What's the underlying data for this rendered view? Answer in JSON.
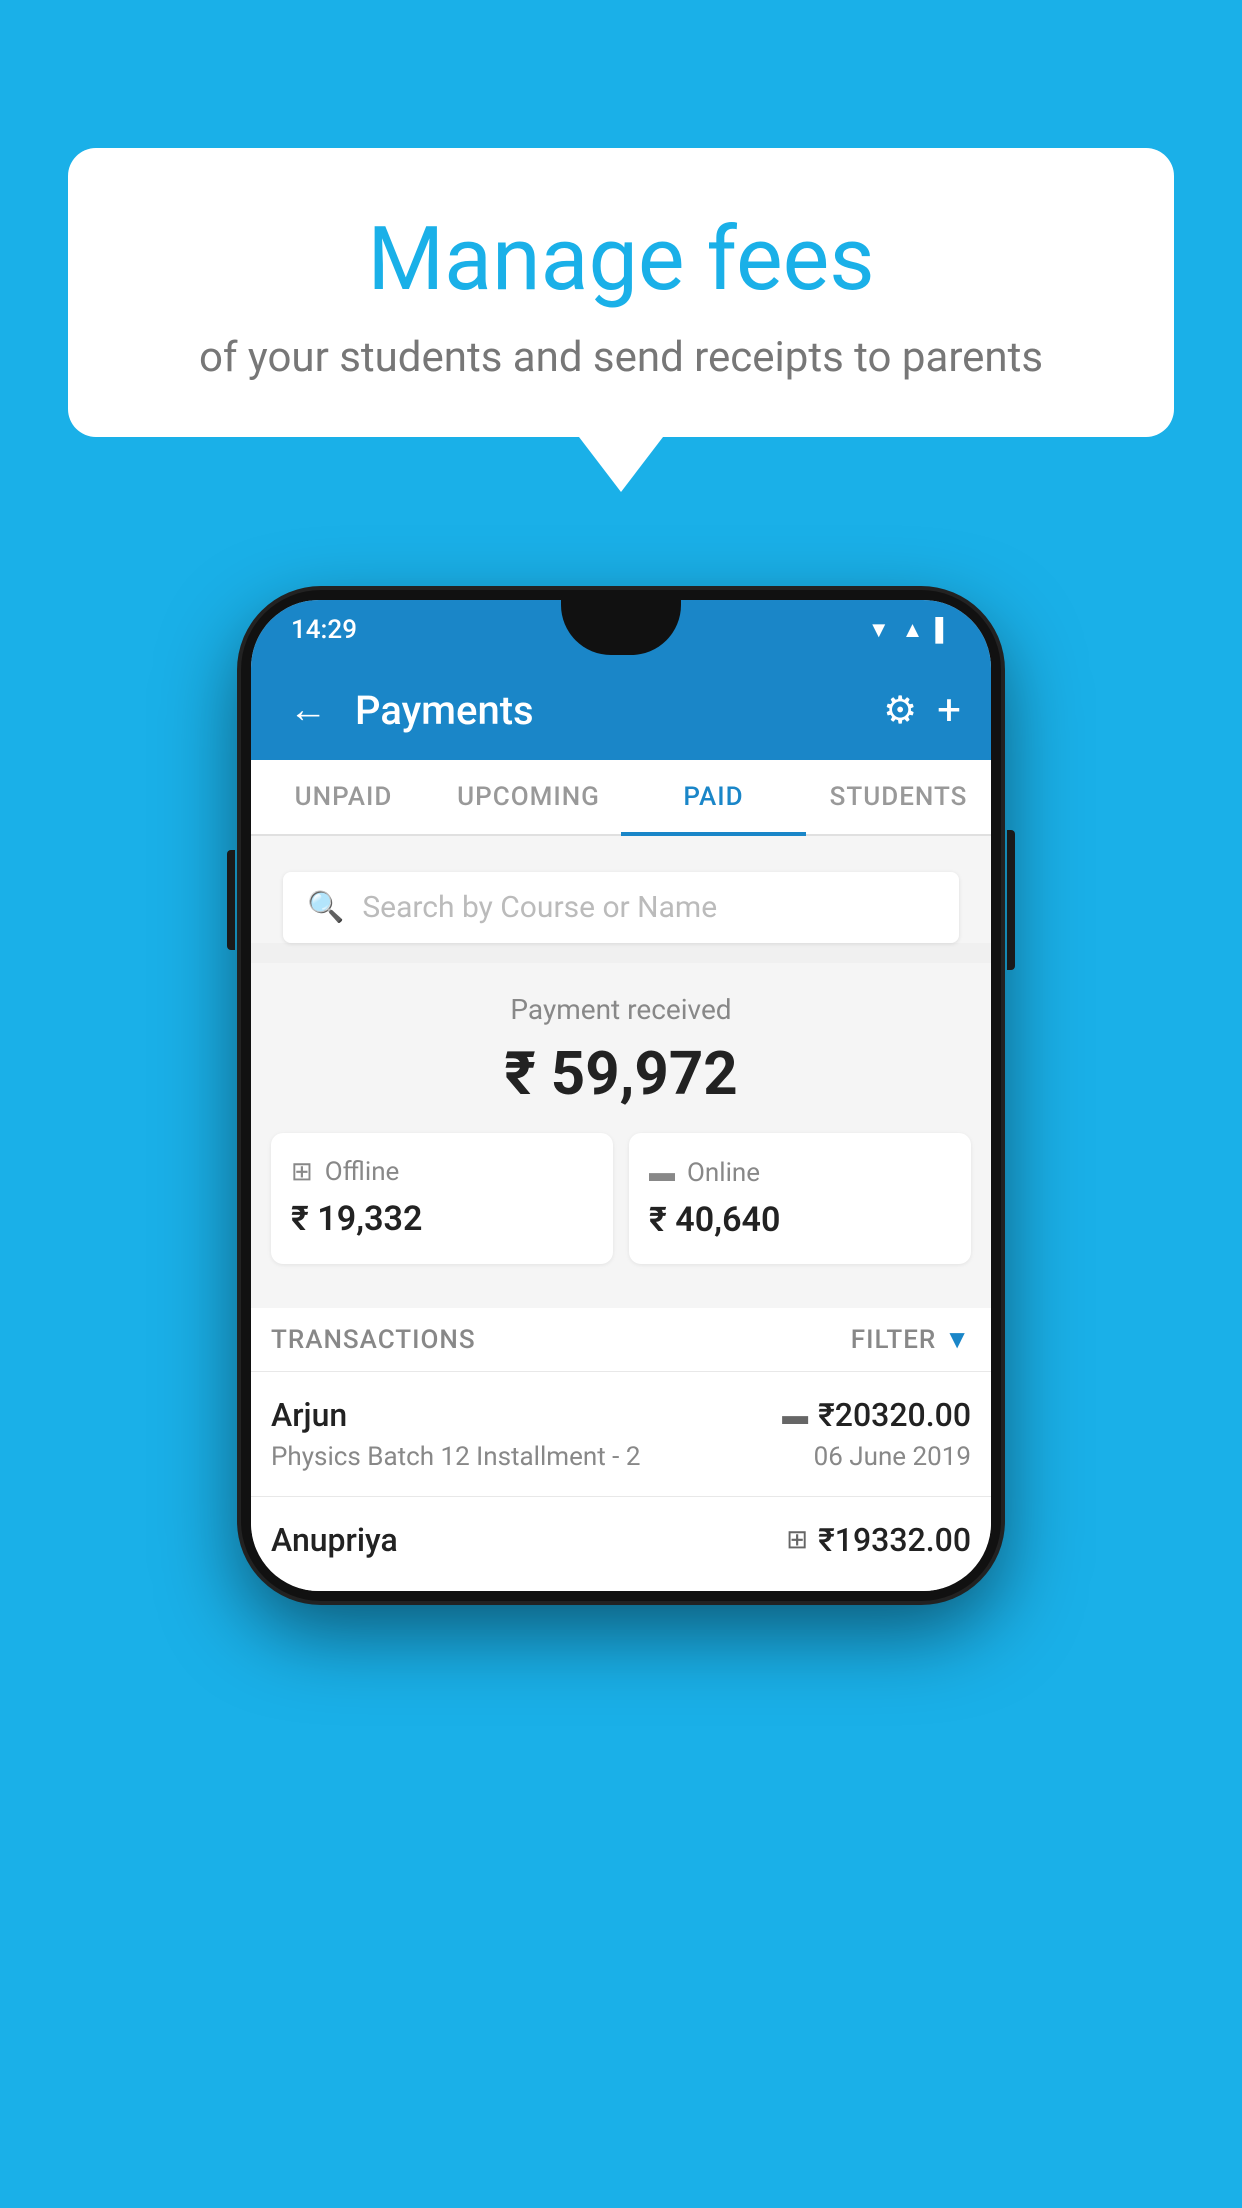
{
  "background_color": "#1ab0e8",
  "speech_bubble": {
    "title": "Manage fees",
    "subtitle": "of your students and send receipts to parents"
  },
  "status_bar": {
    "time": "14:29",
    "wifi": "▼",
    "signal": "▲",
    "battery": "▌"
  },
  "app_bar": {
    "title": "Payments",
    "back_icon": "←",
    "gear_icon": "⚙",
    "plus_icon": "+"
  },
  "tabs": [
    {
      "label": "UNPAID",
      "active": false
    },
    {
      "label": "UPCOMING",
      "active": false
    },
    {
      "label": "PAID",
      "active": true
    },
    {
      "label": "STUDENTS",
      "active": false
    }
  ],
  "search": {
    "placeholder": "Search by Course or Name"
  },
  "payment_summary": {
    "received_label": "Payment received",
    "received_amount": "₹ 59,972",
    "offline_label": "Offline",
    "offline_amount": "₹ 19,332",
    "online_label": "Online",
    "online_amount": "₹ 40,640"
  },
  "transactions": {
    "header_label": "TRANSACTIONS",
    "filter_label": "FILTER",
    "items": [
      {
        "name": "Arjun",
        "amount": "₹20320.00",
        "course": "Physics Batch 12 Installment - 2",
        "date": "06 June 2019",
        "payment_type": "card"
      },
      {
        "name": "Anupriya",
        "amount": "₹19332.00",
        "course": "",
        "date": "",
        "payment_type": "offline"
      }
    ]
  }
}
